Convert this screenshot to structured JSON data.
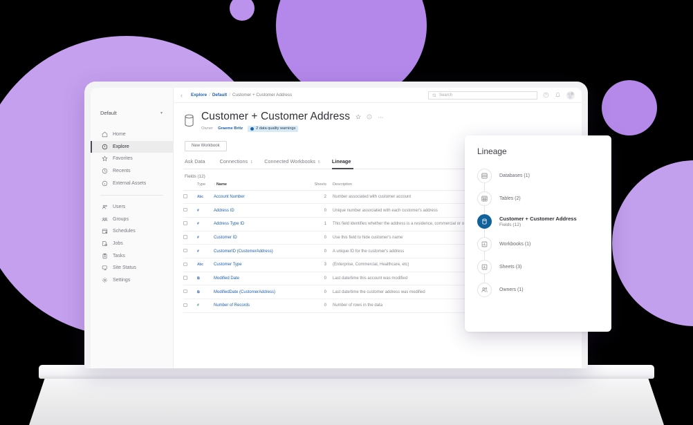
{
  "sidebar": {
    "site_selector": {
      "label": "Default",
      "caret": "chevron-down-icon"
    },
    "items_primary": [
      {
        "label": "Home",
        "icon": "home-icon",
        "active": false
      },
      {
        "label": "Explore",
        "icon": "compass-icon",
        "active": true
      },
      {
        "label": "Favorites",
        "icon": "star-icon",
        "active": false
      },
      {
        "label": "Recents",
        "icon": "clock-icon",
        "active": false
      },
      {
        "label": "External Assets",
        "icon": "external-assets-icon",
        "active": false
      }
    ],
    "items_secondary": [
      {
        "label": "Users",
        "icon": "users-icon"
      },
      {
        "label": "Groups",
        "icon": "groups-icon"
      },
      {
        "label": "Schedules",
        "icon": "calendar-icon"
      },
      {
        "label": "Jobs",
        "icon": "jobs-icon"
      },
      {
        "label": "Tasks",
        "icon": "clipboard-icon"
      },
      {
        "label": "Site Status",
        "icon": "monitor-icon"
      },
      {
        "label": "Settings",
        "icon": "gear-icon"
      }
    ]
  },
  "topbar": {
    "collapse_icon": "chevron-left-icon",
    "breadcrumb": [
      {
        "label": "Explore",
        "type": "link"
      },
      {
        "label": "Default",
        "type": "link"
      },
      {
        "label": "Customer + Customer Address",
        "type": "current"
      }
    ],
    "breadcrumb_separator": "/",
    "search": {
      "placeholder": "Search",
      "value": "",
      "icon": "search-icon"
    },
    "help_icon": "help-circle-icon",
    "notifications_icon": "bell-icon",
    "avatar": "user-avatar"
  },
  "datasource": {
    "icon": "database-cylinder-icon",
    "title": "Customer + Customer Address",
    "favorite_icon": "star-outline-icon",
    "info_icon": "info-circle-icon",
    "more_icon": "ellipsis-icon",
    "owner_label": "Owner",
    "owner_name": "Graeme Britz",
    "quality_badge": "2 data quality warnings",
    "new_workbook_label": "New Workbook"
  },
  "tabs": [
    {
      "label": "Ask Data",
      "count": "",
      "active": false
    },
    {
      "label": "Connections",
      "count": "1",
      "active": false
    },
    {
      "label": "Connected Workbooks",
      "count": "5",
      "active": false
    },
    {
      "label": "Lineage",
      "count": "",
      "active": true
    }
  ],
  "fields_section": {
    "label": "Fields (12)",
    "columns": {
      "checkbox": "",
      "type": "Type",
      "name": "Name",
      "name_sort": "↑",
      "sheets": "Sheets",
      "description": "Description"
    },
    "rows": [
      {
        "type_icon": "abc",
        "type_glyph": "Abc",
        "name": "Account Number",
        "sheets": "2",
        "description": "Number associated with customer account"
      },
      {
        "type_icon": "num",
        "type_glyph": "#",
        "name": "Address ID",
        "sheets": "0",
        "description": "Unique number associated with each customer's address"
      },
      {
        "type_icon": "num",
        "type_glyph": "#",
        "name": "Address Type ID",
        "sheets": "1",
        "description": "This field identifies whether the address is a residence, commercial or o"
      },
      {
        "type_icon": "num",
        "type_glyph": "#",
        "name": "Customer ID",
        "sheets": "0",
        "description": "Use this field to hide customer's name"
      },
      {
        "type_icon": "num",
        "type_glyph": "#",
        "name": "CustomerID (CustomerAddress)",
        "sheets": "0",
        "description": "A unique ID for the customer's address"
      },
      {
        "type_icon": "abc",
        "type_glyph": "Abc",
        "name": "Customer Type",
        "sheets": "3",
        "description": "(Enterprise, Commercial, Healthcare, etc)"
      },
      {
        "type_icon": "date",
        "type_glyph": "⧉",
        "name": "Modified Date",
        "sheets": "0",
        "description": "Last date/time this account was modified"
      },
      {
        "type_icon": "date",
        "type_glyph": "⧉",
        "name": "ModifiedDate (CustomerAddress)",
        "sheets": "0",
        "description": "Last date/time the customer address was modified"
      },
      {
        "type_icon": "green",
        "type_glyph": "#",
        "name": "Number of Records",
        "sheets": "0",
        "description": "Number of rows in the data"
      }
    ]
  },
  "lineage": {
    "title": "Lineage",
    "items": [
      {
        "label": "Databases (1)",
        "icon": "database-list-icon",
        "active": false,
        "sub": ""
      },
      {
        "label": "Tables (2)",
        "icon": "table-grid-icon",
        "active": false,
        "sub": ""
      },
      {
        "label": "Customer + Customer Address",
        "icon": "datasource-cylinder-icon",
        "active": true,
        "sub": "Fields (12)"
      },
      {
        "label": "Workbooks (1)",
        "icon": "workbook-icon",
        "active": false,
        "sub": ""
      },
      {
        "label": "Sheets (3)",
        "icon": "sheet-chart-icon",
        "active": false,
        "sub": ""
      },
      {
        "label": "Owners (1)",
        "icon": "owners-people-icon",
        "active": false,
        "sub": ""
      }
    ]
  },
  "colors": {
    "accent_blue": "#1c5fb0",
    "lineage_active": "#10629b",
    "badge_bg": "#d9eaf7",
    "blob_light": "#c5a0ef",
    "blob_dark": "#b388ea",
    "background": "#000000"
  }
}
